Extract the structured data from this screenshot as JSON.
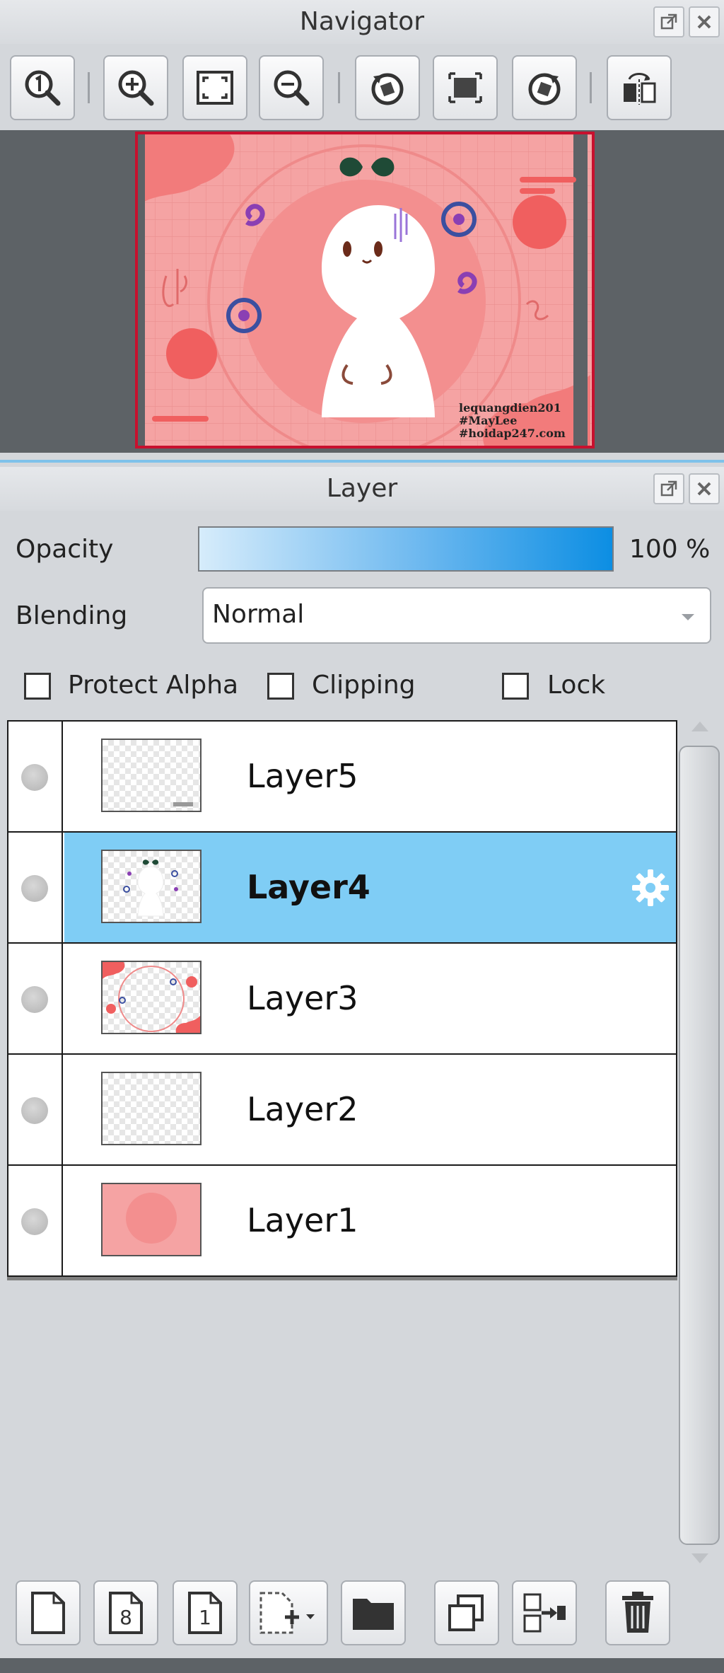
{
  "navigator": {
    "title": "Navigator",
    "toolbar": [
      {
        "icon": "zoom-actual-icon"
      },
      {
        "icon": "zoom-in-icon"
      },
      {
        "icon": "fit-screen-icon"
      },
      {
        "icon": "zoom-out-icon"
      },
      {
        "icon": "rotate-left-icon"
      },
      {
        "icon": "reset-view-icon"
      },
      {
        "icon": "rotate-right-icon"
      },
      {
        "icon": "flip-horizontal-icon"
      }
    ],
    "preview": {
      "watermark_lines": [
        "lequangdien201",
        "#MayLee",
        "#hoidap247.com"
      ]
    }
  },
  "layer_panel": {
    "title": "Layer",
    "opacity_label": "Opacity",
    "opacity_value": "100 %",
    "opacity_fraction": 1.0,
    "blending_label": "Blending",
    "blending_value": "Normal",
    "checkboxes": {
      "protect_alpha": "Protect Alpha",
      "clipping": "Clipping",
      "lock": "Lock"
    },
    "layers": [
      {
        "name": "Layer5",
        "selected": false
      },
      {
        "name": "Layer4",
        "selected": true
      },
      {
        "name": "Layer3",
        "selected": false
      },
      {
        "name": "Layer2",
        "selected": false
      },
      {
        "name": "Layer1",
        "selected": false
      }
    ],
    "bottom_toolbar": [
      {
        "icon": "new-layer-icon"
      },
      {
        "icon": "new-8bit-layer-icon",
        "text": "8"
      },
      {
        "icon": "new-1bit-layer-icon",
        "text": "1"
      },
      {
        "icon": "add-layer-menu-icon"
      },
      {
        "icon": "new-folder-icon"
      },
      {
        "icon": "duplicate-layer-icon"
      },
      {
        "icon": "merge-down-icon"
      },
      {
        "icon": "delete-layer-icon"
      }
    ]
  },
  "colors": {
    "selected_row": "#7fcdf5",
    "accent_blue": "#0c8ee3",
    "canvas_pink": "#f5a3a3"
  }
}
